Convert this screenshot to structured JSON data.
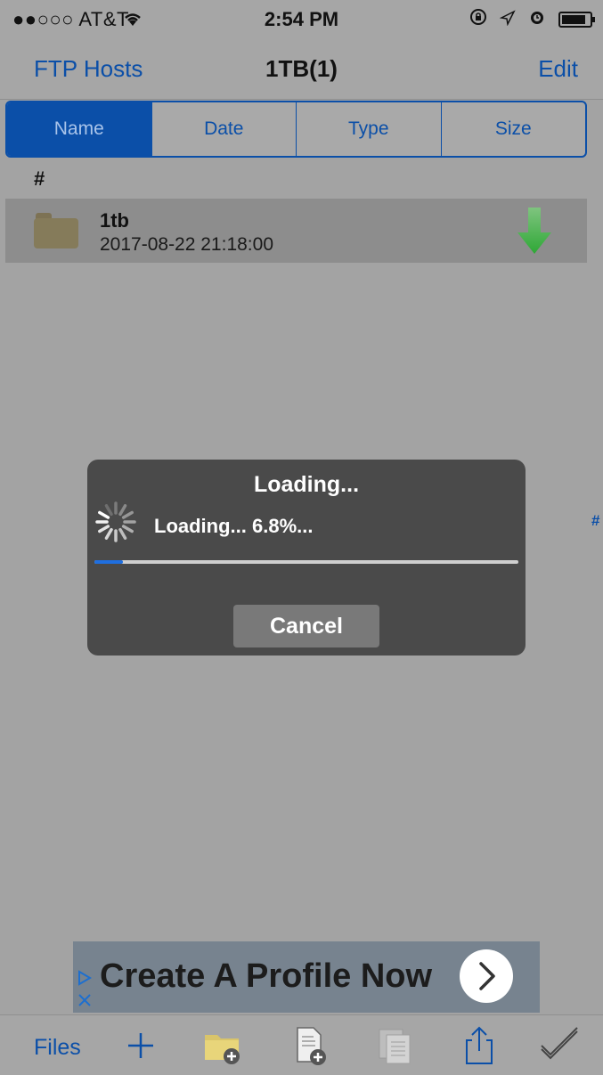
{
  "status_bar": {
    "carrier": "●●○○○ AT&T",
    "time": "2:54 PM",
    "icons": [
      "wifi-icon",
      "orientation-lock-icon",
      "location-icon",
      "alarm-icon",
      "battery-icon"
    ]
  },
  "nav": {
    "back_label": "FTP Hosts",
    "title": "1TB(1)",
    "edit_label": "Edit"
  },
  "sort_tabs": [
    {
      "label": "Name",
      "active": true
    },
    {
      "label": "Date",
      "active": false
    },
    {
      "label": "Type",
      "active": false
    },
    {
      "label": "Size",
      "active": false
    }
  ],
  "section_header": "#",
  "files": [
    {
      "name": "1tb",
      "date": "2017-08-22 21:18:00",
      "icon": "folder-icon",
      "action_icon": "download-icon"
    }
  ],
  "index_label": "#",
  "loading_dialog": {
    "title": "Loading...",
    "status": "Loading... 6.8%...",
    "progress_percent": 6.8,
    "cancel_label": "Cancel"
  },
  "ad": {
    "text": "Create A Profile Now",
    "icons": [
      "adchoices-icon",
      "close-icon",
      "chevron-right-icon"
    ]
  },
  "toolbar": {
    "files_label": "Files",
    "icons": [
      "add-icon",
      "new-folder-icon",
      "new-file-icon",
      "paste-icon",
      "share-icon",
      "select-icon"
    ]
  },
  "colors": {
    "accent": "#0b4fa8",
    "background": "#a3a3a3",
    "dialog": "#4a4a4a",
    "progress": "#1f6fe0",
    "download_arrow": "#2ea836"
  }
}
